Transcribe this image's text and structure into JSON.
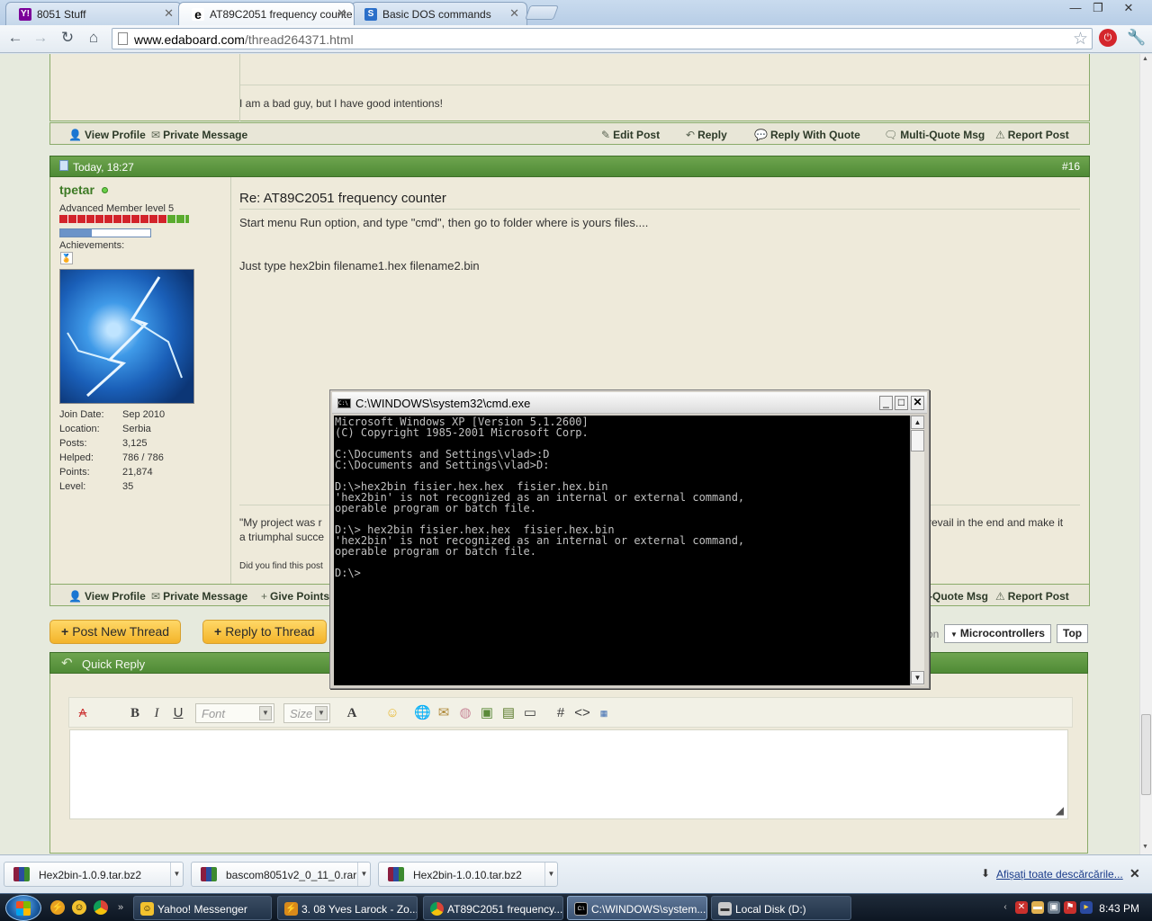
{
  "tabs": [
    {
      "label": "8051 Stuff",
      "favicon": "Y!",
      "active": false
    },
    {
      "label": "AT89C2051 frequency counte",
      "favicon": "e",
      "active": true
    },
    {
      "label": "Basic DOS commands",
      "favicon": "S",
      "active": false
    }
  ],
  "toolbar": {
    "url_domain": "www.edaboard.com",
    "url_path": "/thread264371.html"
  },
  "previous_post": {
    "signature": "I am a bad guy, but I have good intentions!",
    "footer_left": [
      "View Profile",
      "Private Message"
    ],
    "footer_right": [
      "Edit Post",
      "Reply",
      "Reply With Quote",
      "Multi-Quote Msg",
      "Report Post"
    ]
  },
  "post": {
    "date": "Today, 18:27",
    "number": "#16",
    "username": "tpetar",
    "rank": "Advanced Member level 5",
    "achievements_label": "Achievements:",
    "info": [
      {
        "label": "Join Date:",
        "value": "Sep 2010"
      },
      {
        "label": "Location:",
        "value": "Serbia"
      },
      {
        "label": "Posts:",
        "value": "3,125"
      },
      {
        "label": "Helped:",
        "value": "786 / 786"
      },
      {
        "label": "Points:",
        "value": "21,874"
      },
      {
        "label": "Level:",
        "value": "35"
      }
    ],
    "title": "Re: AT89C2051 frequency counter",
    "body_line1": "Start menu Run option, and type \"cmd\", then go to folder where is yours files....",
    "body_line2": "Just type hex2bin filename1.hex filename2.bin",
    "sig_part1": "\"My project was r",
    "sig_part1b": "a triumphal succe",
    "sig_part2": "revail in the end and make it",
    "did_you_find": "Did you find this post",
    "footer_left": [
      "View Profile",
      "Private Message",
      "Give Points"
    ],
    "footer_right": [
      "-Quote Msg",
      "Report Post"
    ]
  },
  "actions": {
    "post_new_thread": "Post New Thread",
    "reply_to_thread": "Reply to Thread",
    "nav_fragment": "on",
    "forum_select": "Microcontrollers",
    "top": "Top"
  },
  "quick_reply": {
    "header": "Quick Reply",
    "font_placeholder": "Font",
    "size_placeholder": "Size"
  },
  "cmd": {
    "title": "C:\\WINDOWS\\system32\\cmd.exe",
    "lines": [
      "Microsoft Windows XP [Version 5.1.2600]",
      "(C) Copyright 1985-2001 Microsoft Corp.",
      "",
      "C:\\Documents and Settings\\vlad>:D",
      "C:\\Documents and Settings\\vlad>D:",
      "",
      "D:\\>hex2bin fisier.hex.hex  fisier.hex.bin",
      "'hex2bin' is not recognized as an internal or external command,",
      "operable program or batch file.",
      "",
      "D:\\> hex2bin fisier.hex.hex  fisier.hex.bin",
      "'hex2bin' is not recognized as an internal or external command,",
      "operable program or batch file.",
      "",
      "D:\\>"
    ]
  },
  "downloads": [
    {
      "name": "Hex2bin-1.0.9.tar.bz2"
    },
    {
      "name": "bascom8051v2_0_11_0.rar"
    },
    {
      "name": "Hex2bin-1.0.10.tar.bz2"
    }
  ],
  "downloads_show_all": "Afișați toate descărcările...",
  "taskbar": {
    "tasks": [
      {
        "label": "Yahoo! Messenger",
        "active": false
      },
      {
        "label": "3. 08 Yves Larock - Zo...",
        "active": false
      },
      {
        "label": "AT89C2051 frequency...",
        "active": false
      },
      {
        "label": "C:\\WINDOWS\\system...",
        "active": true
      },
      {
        "label": "Local Disk (D:)",
        "active": false
      }
    ],
    "clock": "8:43 PM"
  },
  "colors": {
    "forum_green": "#4f8a35",
    "post_bg": "#eeeada",
    "button_yellow": "#f3b42a",
    "cmd_bg": "#000000",
    "cmd_text": "#c0c0c0"
  }
}
